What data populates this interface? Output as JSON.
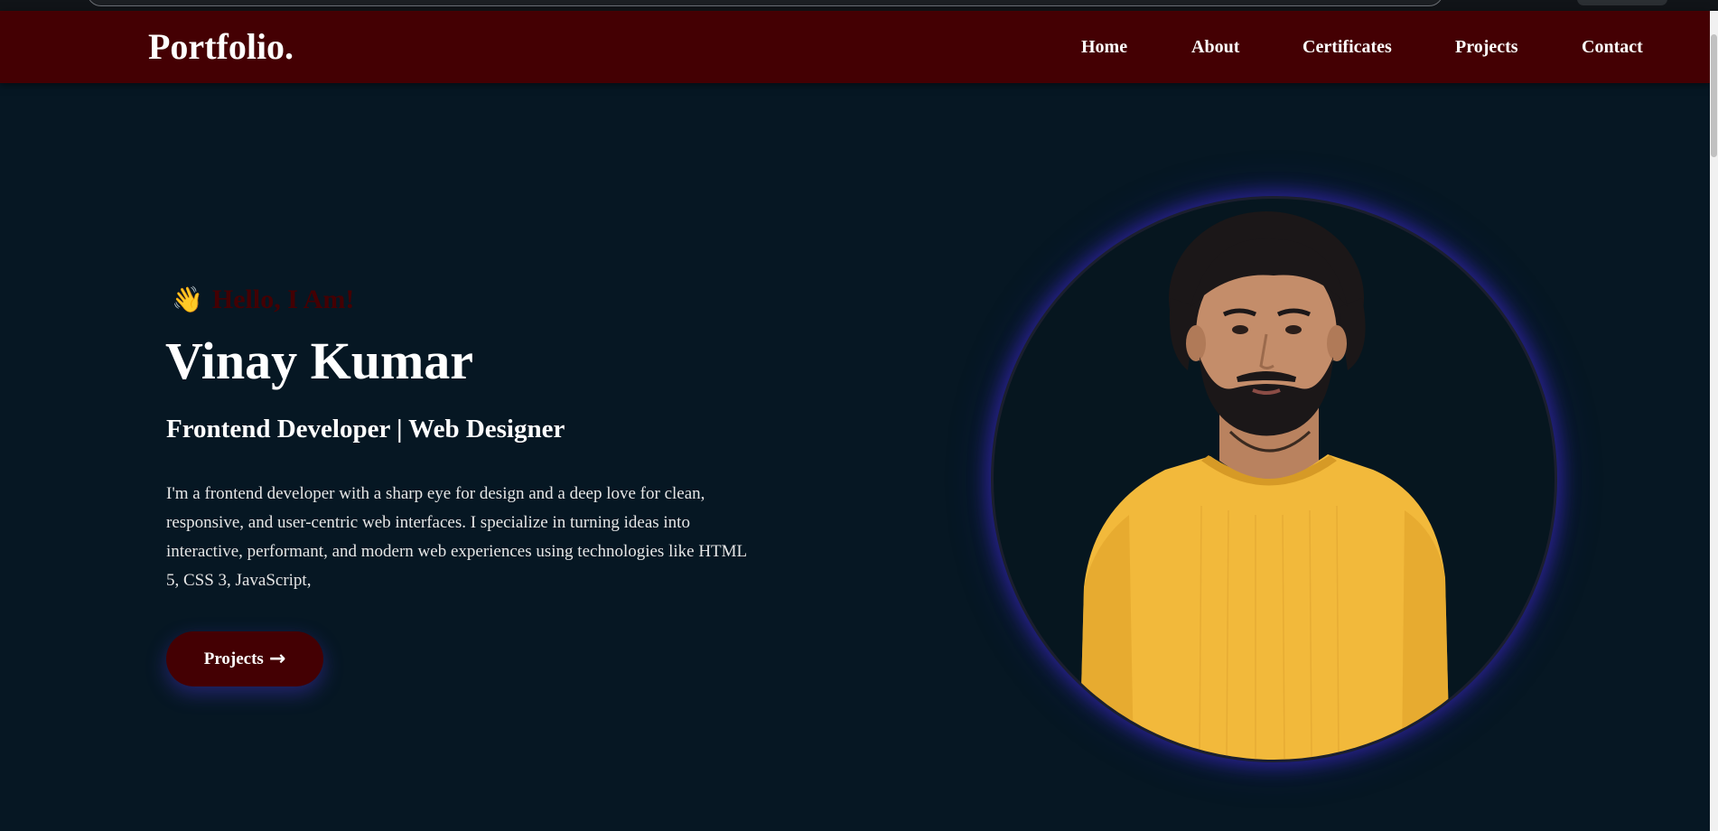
{
  "navbar": {
    "logo": "Portfolio.",
    "links": [
      "Home",
      "About",
      "Certificates",
      "Projects",
      "Contact"
    ],
    "background": "#440003"
  },
  "hero": {
    "wave_icon": "👋",
    "greeting": "Hello, I Am!",
    "name": "Vinay Kumar",
    "role": "Frontend Developer | Web Designer",
    "bio": "I'm a frontend developer with a sharp eye for design and a deep love for clean, responsive, and user-centric web interfaces. I specialize in turning ideas into interactive, performant, and modern web experiences using technologies like HTML 5, CSS 3, JavaScript,",
    "button_label": "Projects",
    "button_arrow": "→"
  },
  "portrait": {
    "shirt_color": "#f2b93b",
    "glow_color": "#3c28c8"
  },
  "colors": {
    "page_background": "#061723",
    "accent": "#440003",
    "text": "#ffffff"
  }
}
